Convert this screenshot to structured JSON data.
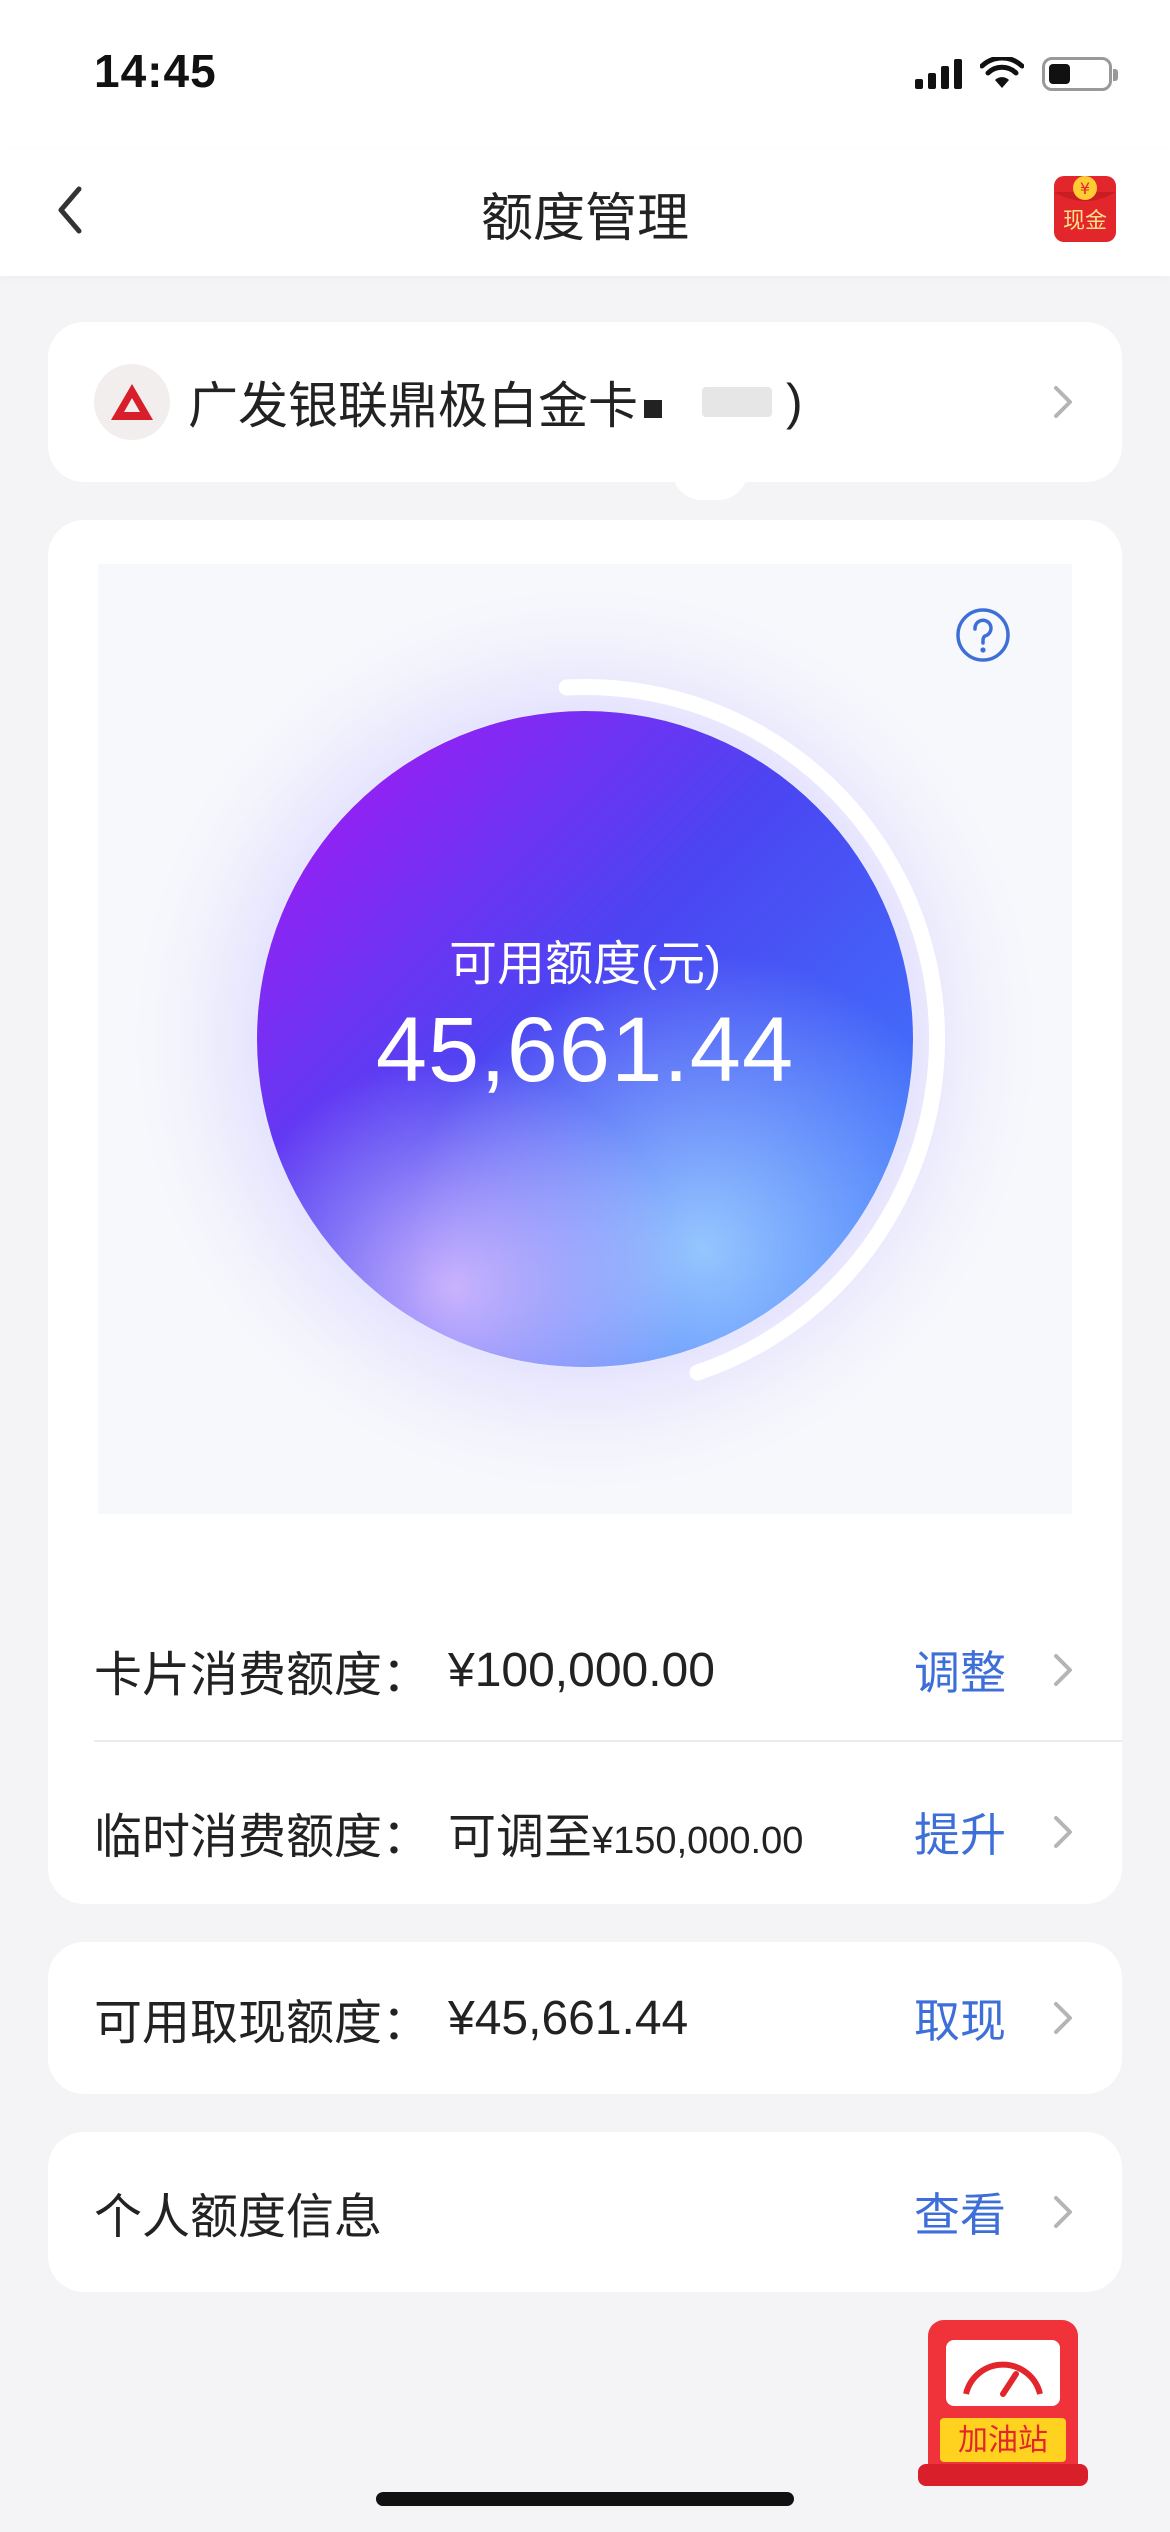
{
  "status_bar": {
    "time": "14:45"
  },
  "nav": {
    "title": "额度管理",
    "cash_badge_top": "¥",
    "cash_badge_label": "现金"
  },
  "card_selector": {
    "name": "广发银联鼎极白金卡",
    "suffix": ")"
  },
  "gauge": {
    "label": "可用额度(元)",
    "value": "45,661.44",
    "remaining_fraction": 0.4566,
    "colors": {
      "start": "#b013f5",
      "mid": "#4b45f2",
      "end": "#3c86ff"
    }
  },
  "rows": {
    "consumption": {
      "label": "卡片消费额度：",
      "value": "¥100,000.00",
      "action": "调整"
    },
    "temporary": {
      "label": "临时消费额度：",
      "value_prefix": "可调至",
      "value": "¥150,000.00",
      "action": "提升"
    },
    "cash": {
      "label": "可用取现额度：",
      "value": "¥45,661.44",
      "action": "取现"
    },
    "personal": {
      "label": "个人额度信息",
      "action": "查看"
    }
  },
  "fuel_station": {
    "label": "加油站"
  },
  "colors": {
    "accent": "#3e6fd8",
    "brand_red": "#e2262b"
  }
}
